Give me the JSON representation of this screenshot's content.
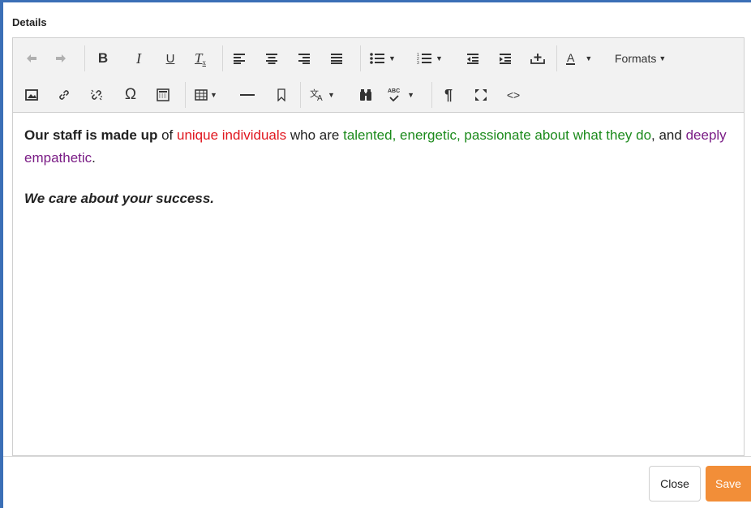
{
  "field_label": "Details",
  "toolbar": {
    "formats_label": "Formats",
    "font_color_letter": "A",
    "bold_letter": "B",
    "italic_letter": "I",
    "underline_letter": "U",
    "clear_format_letter": "T",
    "special_char_glyph": "Ω",
    "paragraph_glyph": "¶",
    "code_glyph": "<>",
    "spellcheck_text": "ABC"
  },
  "content": {
    "paragraph1": {
      "bold": "Our staff is made up",
      "t1": " of ",
      "red": "unique individuals",
      "t2": " who are ",
      "green": "talented, energetic, passionate about what they do",
      "t3": ", and ",
      "purple": "deeply empathetic",
      "t4": "."
    },
    "paragraph2": "We care about your success."
  },
  "footer": {
    "close_label": "Close",
    "save_label": "Save"
  },
  "colors": {
    "accent_frame": "#3b6fb6",
    "save_button": "#f28e38",
    "text_red": "#e0161e",
    "text_green": "#1b8a1b",
    "text_purple": "#7b1d86"
  }
}
